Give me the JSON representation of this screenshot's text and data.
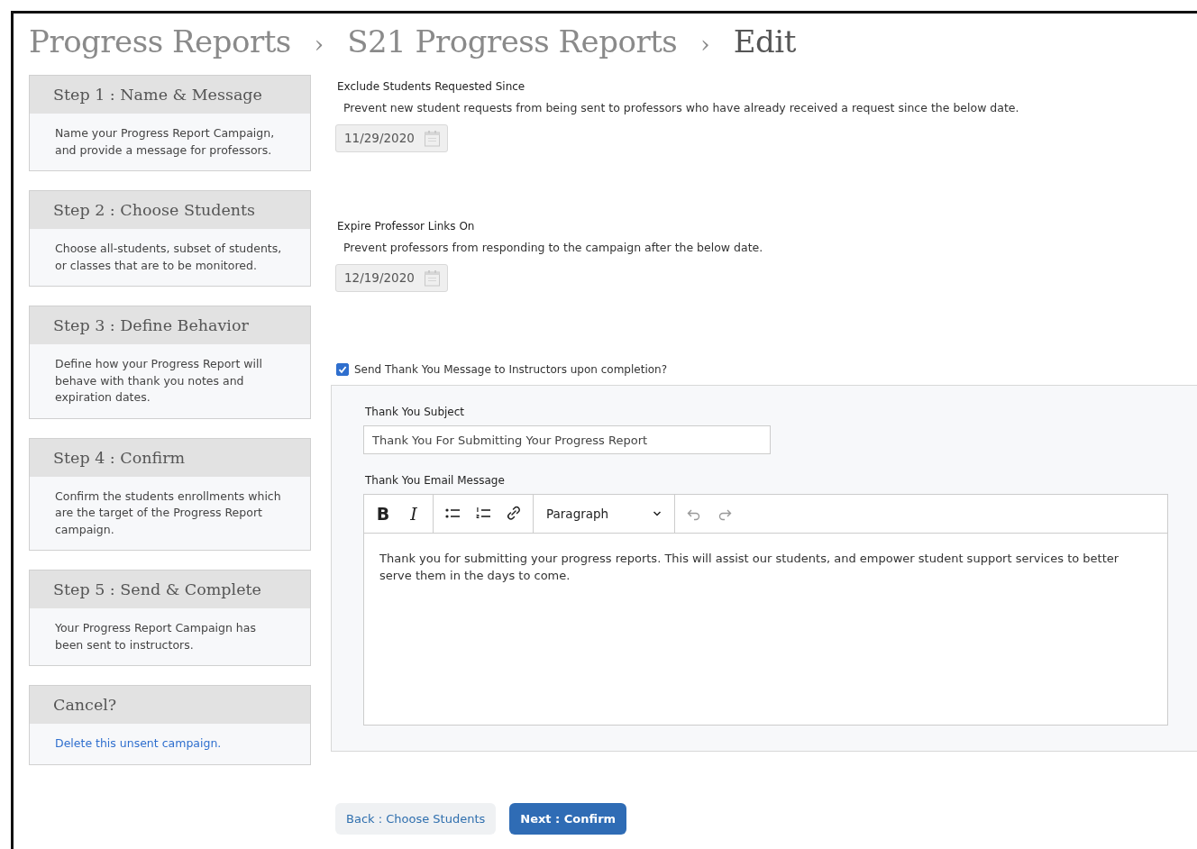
{
  "breadcrumb": [
    {
      "kind": "crumb",
      "label": "Progress Reports",
      "current": false
    },
    {
      "kind": "separator",
      "label": "›"
    },
    {
      "kind": "crumb",
      "label": "S21 Progress Reports",
      "current": false
    },
    {
      "kind": "separator",
      "label": "›"
    },
    {
      "kind": "crumb",
      "label": "Edit",
      "current": true
    }
  ],
  "steps": [
    {
      "kind": "text",
      "title": "Step 1 : Name & Message",
      "description": "Name your Progress Report Campaign, and provide a message for professors."
    },
    {
      "kind": "text",
      "title": "Step 2 : Choose Students",
      "description": "Choose all-students, subset of students, or classes that are to be monitored."
    },
    {
      "kind": "text",
      "title": "Step 3 : Define Behavior",
      "description": "Define how your Progress Report will behave with thank you notes and expiration dates."
    },
    {
      "kind": "text",
      "title": "Step 4 : Confirm",
      "description": "Confirm the students enrollments which are the target of the Progress Report campaign."
    },
    {
      "kind": "text",
      "title": "Step 5 : Send & Complete",
      "description": "Your Progress Report Campaign has been sent to instructors."
    },
    {
      "kind": "link",
      "title": "Cancel?",
      "description": "Delete this unsent campaign."
    }
  ],
  "date_fields": [
    {
      "label": "Exclude Students Requested Since",
      "description": "Prevent new student requests from being sent to professors who have already received a request since the below date.",
      "value": "11/29/2020",
      "disabled": true
    },
    {
      "label": "Expire Professor Links On",
      "description": "Prevent professors from responding to the campaign after the below date.",
      "value": "12/19/2020",
      "disabled": true
    }
  ],
  "thank_you": {
    "label": "Send Thank You Message to Instructors upon completion?",
    "checked": true,
    "subject": {
      "label": "Thank You Subject",
      "value": "Thank You For Submitting Your Progress Report"
    },
    "message": {
      "label": "Thank You Email Message",
      "format": "Paragraph",
      "toolbar": [
        {
          "kind": "bold",
          "label": "B"
        },
        {
          "kind": "italic",
          "label": "I"
        },
        {
          "kind": "bullets"
        },
        {
          "kind": "numbers"
        },
        {
          "kind": "link"
        },
        {
          "kind": "format"
        },
        {
          "kind": "undo"
        },
        {
          "kind": "redo"
        }
      ],
      "body": "Thank you for submitting your progress reports. This will assist our students, and empower student support services to better serve them in the days to come."
    }
  },
  "buttons": [
    {
      "kind": "secondary",
      "label": "Back : Choose Students"
    },
    {
      "kind": "primary",
      "label": "Next : Confirm"
    }
  ]
}
